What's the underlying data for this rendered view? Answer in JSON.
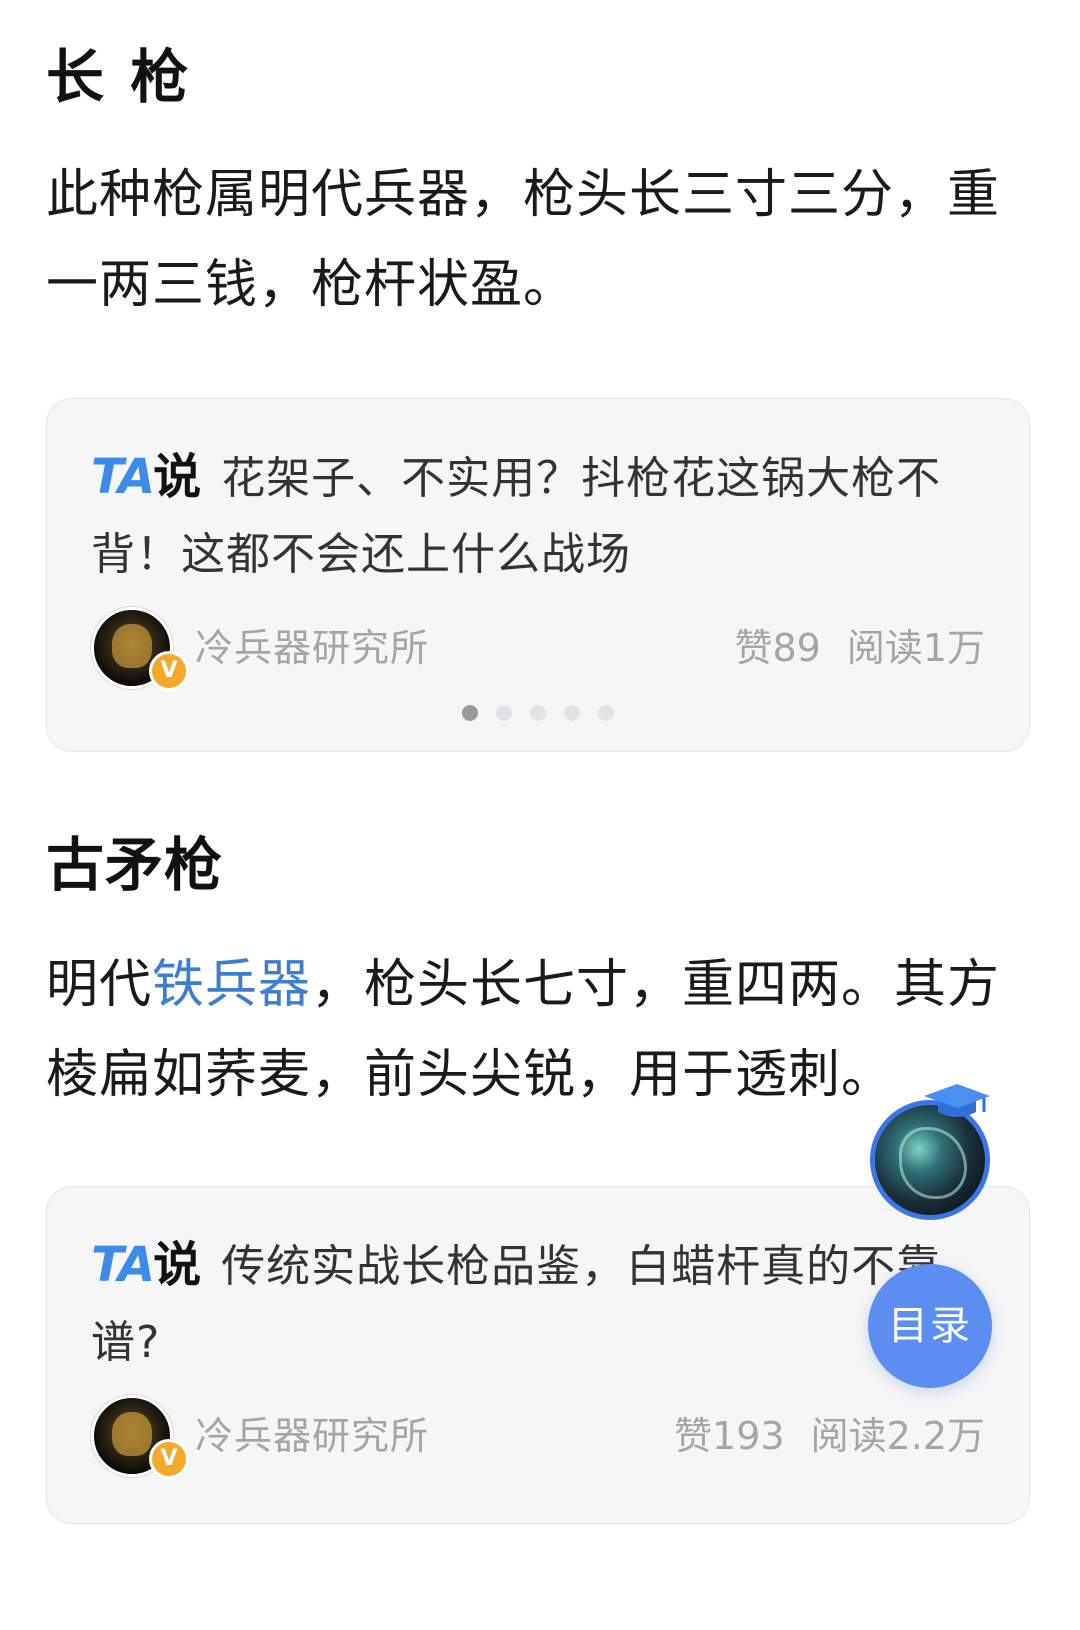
{
  "sections": [
    {
      "title": "长 枪",
      "body": "此种枪属明代兵器，枪头长三寸三分，重一两三钱，枪杆状盈。"
    },
    {
      "title": "古矛枪",
      "body_prefix": "明代",
      "body_link": "铁兵器",
      "body_suffix": "，枪头长七寸，重四两。其方棱扁如荞麦，前头尖锐，用于透刺。"
    }
  ],
  "ta_logo": {
    "ta": "TA",
    "shuo": "说"
  },
  "cards": [
    {
      "text": "花架子、不实用？抖枪花这锅大枪不背！这都不会还上什么战场",
      "author": "冷兵器研究所",
      "likes": "赞89",
      "reads": "阅读1万",
      "verified": "V",
      "pager_total": 5,
      "pager_active": 1
    },
    {
      "text": "传统实战长枪品鉴，白蜡杆真的不靠谱?",
      "author": "冷兵器研究所",
      "likes": "赞193",
      "reads": "阅读2.2万",
      "verified": "V"
    }
  ],
  "floating": {
    "toc_label": "目录"
  },
  "colors": {
    "link": "#3e7ed0",
    "ta_blue": "#3d8be8",
    "toc_button": "#5b8ef0",
    "verified_badge": "#f4a92a"
  },
  "icons": {
    "avatar": "author-avatar",
    "badge": "verified-badge-icon",
    "assistant": "ai-assistant-avatar",
    "cap": "graduation-cap-icon"
  }
}
